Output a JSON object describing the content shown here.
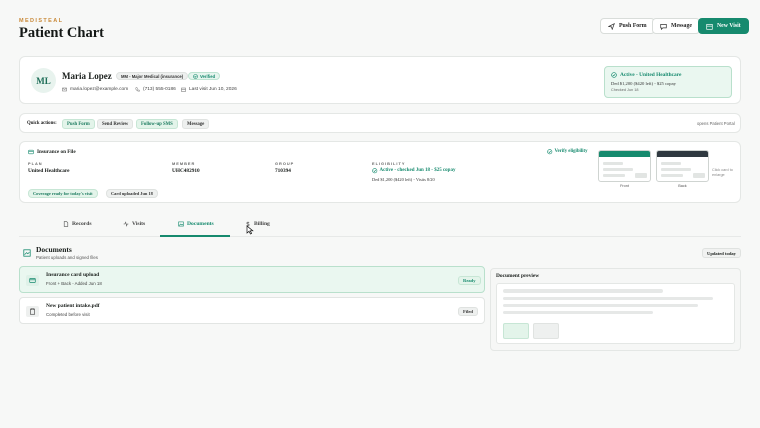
{
  "header": {
    "brand": "MEDISTEAL",
    "title": "Patient Chart",
    "buttons": {
      "push_form": "Push Form",
      "message": "Message",
      "new_visit": "New Visit"
    }
  },
  "patient": {
    "initials": "ML",
    "name": "Maria Lopez",
    "plan_badge": "MM - Major Medical (insurance)",
    "verified_badge": "Verified",
    "email": "maria.lopez@example.com",
    "phone": "(713) 555-0186",
    "last_visit": "Last visit Jun 10, 2026",
    "status": {
      "title": "Active - United Healthcare",
      "detail": "Ded $1,200 ($420 left) - $25 copay",
      "checked": "Checked Jun 18"
    }
  },
  "quick_actions": {
    "label": "Quick actions:",
    "items": [
      "Push Form",
      "Send Review",
      "Follow-up SMS",
      "Message"
    ],
    "right_link": "opens Patient Portal"
  },
  "insurance": {
    "title": "Insurance on File",
    "verify": "Verify eligibility",
    "columns": [
      {
        "label": "PLAN",
        "value": "United Healthcare"
      },
      {
        "label": "MEMBER",
        "value": "UHC482910"
      },
      {
        "label": "GROUP",
        "value": "710394"
      }
    ],
    "eligibility": {
      "label": "ELIGIBILITY",
      "value": "Active - checked Jun 18 - $25 copay",
      "sub": "Ded $1,200 ($420 left) - Visits 8/20"
    },
    "chips": [
      "Coverage ready for today's visit",
      "Card uploaded Jun 18"
    ],
    "card_front": "Front",
    "card_back": "Back",
    "hint": "Click card to enlarge"
  },
  "tabs": [
    "Records",
    "Visits",
    "Documents",
    "Billing"
  ],
  "documents": {
    "title": "Documents",
    "subtitle": "Patient uploads and signed files",
    "updated": "Updated today",
    "items": [
      {
        "name": "Insurance card upload",
        "sub": "Front + Back - Added Jun 18",
        "badge": "Ready"
      },
      {
        "name": "New patient intake.pdf",
        "sub": "Completed before visit",
        "badge": "Filed"
      }
    ],
    "preview_title": "Document preview"
  },
  "colors": {
    "accent": "#168a6e",
    "brand": "#c98a3a",
    "card_dark": "#2f3940"
  }
}
